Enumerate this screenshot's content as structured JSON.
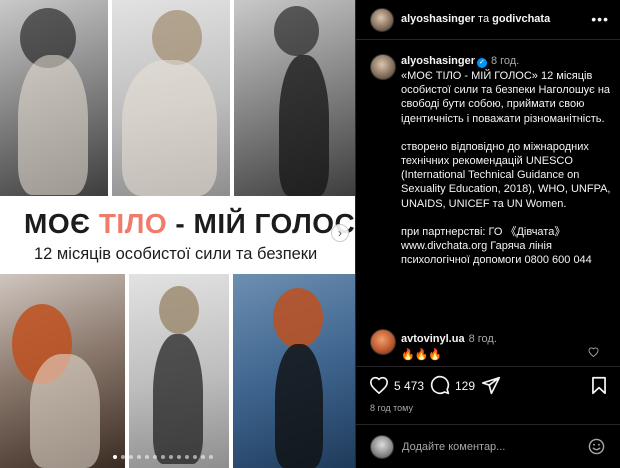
{
  "media": {
    "banner_title_part1": "МОЄ ",
    "banner_title_accent": "ТІЛО",
    "banner_title_part2": " - МІЙ ГОЛОС",
    "banner_subtitle": "12 місяців особистої сили та безпеки",
    "next_arrow": "›",
    "accent_color": "#f07b6b"
  },
  "header": {
    "author": "alyoshasinger",
    "separator": " та ",
    "coauthor": "godivchata",
    "more_icon": "more-horizontal-icon"
  },
  "caption": {
    "author": "alyoshasinger",
    "time": "8 год.",
    "paragraphs": [
      "«МОЄ ТІЛО - МІЙ ГОЛОС» 12 місяців особистої сили та безпеки Наголошує на свободі бути собою, приймати свою ідентичність і поважати різноманітність.",
      "створено відповідно до міжнародних технічних рекомендацій UNESCO (International Technical Guidance on Sexuality Education, 2018), WHO, UNFPA, UNAIDS, UNICEF та UN Women.",
      "при партнерстві: ГО 《Дівчата》 www.divchata.org Гаряча лінія психологічної допомоги 0800 600 044"
    ]
  },
  "comment": {
    "author": "avtovinyl.ua",
    "time": "8 год.",
    "text": "🔥🔥🔥"
  },
  "actions": {
    "likes": "5 473",
    "comments": "129",
    "date": "8 год тому"
  },
  "comment_box": {
    "placeholder": "Додайте коментар..."
  },
  "colors": {
    "verified": "#0095f6",
    "background": "#000000"
  }
}
